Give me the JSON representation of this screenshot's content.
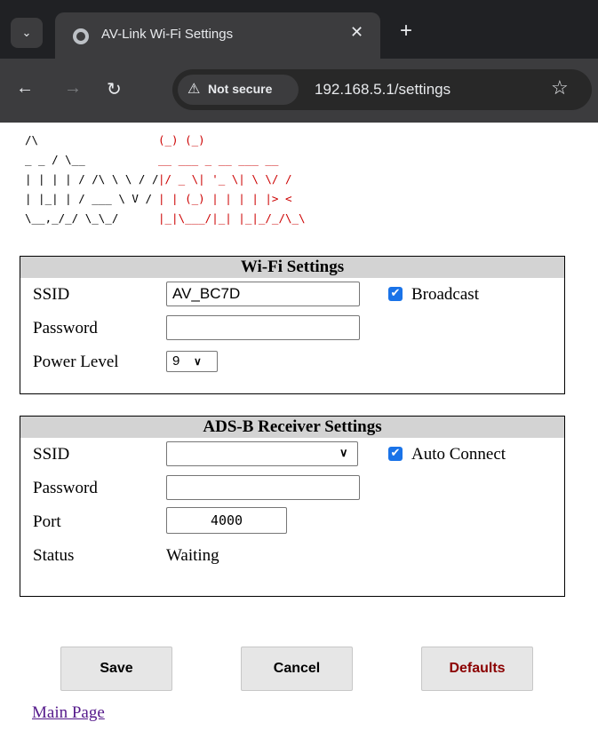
{
  "browser": {
    "tab_title": "AV-Link Wi-Fi Settings",
    "security_label": "Not secure",
    "url": "192.168.5.1/settings"
  },
  "logo": {
    "lines_left": [
      "        /\\",
      " _   _  / \\__",
      "| | | | / /\\ \\ \\ / /",
      "| |_| | /  ___ \\ V /",
      " \\__,_/_/    \\_\\_/"
    ],
    "lines_right": [
      "  (_)          (_)",
      "  __    ___ _ __  ___  __",
      " |/ _ \\| '_ \\| \\ \\/ /",
      " | | (_) | | | | |>  <",
      " |_|\\___/|_| |_|_/_/\\_\\"
    ],
    "colors": {
      "left": "#000000",
      "right": "#cc0000"
    }
  },
  "wifi": {
    "header": "Wi-Fi Settings",
    "ssid_label": "SSID",
    "ssid_value": "AV_BC7D",
    "broadcast_label": "Broadcast",
    "broadcast_checked": true,
    "password_label": "Password",
    "password_value": "",
    "power_label": "Power Level",
    "power_value": "9"
  },
  "adsb": {
    "header": "ADS-B Receiver Settings",
    "ssid_label": "SSID",
    "ssid_value": "",
    "auto_connect_label": "Auto Connect",
    "auto_connect_checked": true,
    "password_label": "Password",
    "password_value": "",
    "port_label": "Port",
    "port_value": "4000",
    "status_label": "Status",
    "status_value": "Waiting"
  },
  "buttons": {
    "save": "Save",
    "cancel": "Cancel",
    "defaults": "Defaults"
  },
  "links": {
    "main_page": "Main Page"
  },
  "icons": {
    "tab_menu": "chevron-down-icon",
    "favicon": "globe-icon",
    "close": "close-icon",
    "new_tab": "plus-icon",
    "back": "arrow-left-icon",
    "forward": "arrow-right-icon",
    "reload": "reload-icon",
    "warning": "warning-icon",
    "bookmark": "star-icon"
  },
  "colors": {
    "checkbox": "#1a73e8",
    "header_bg": "#d3d3d3",
    "defaults_text": "#8b0000",
    "link": "#551a8b"
  }
}
